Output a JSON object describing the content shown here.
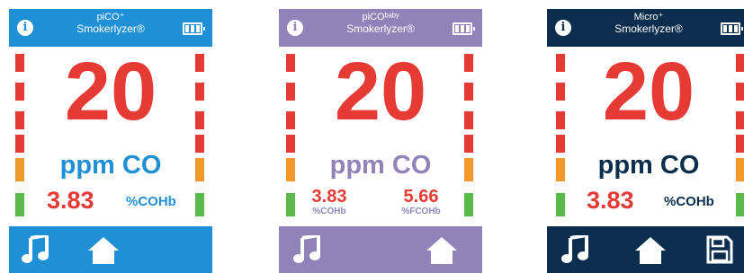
{
  "colors": {
    "pico_blue": "#1f8fd6",
    "baby_purple": "#9182b9",
    "micro_navy": "#0b2d4e",
    "reading_red": "#e63a35",
    "segment_orange": "#f2992b",
    "segment_green": "#5bb84a"
  },
  "screens": [
    {
      "theme": "pico",
      "brand_line1": "piCO⁺",
      "brand_line2": "Smokerlyzer®",
      "reading": "20",
      "unit": "ppm CO",
      "cohb_value": "3.83",
      "cohb_label": "%COHb",
      "icons": [
        "info-icon",
        "battery-icon",
        "music-note-icon",
        "home-icon"
      ]
    },
    {
      "theme": "baby",
      "brand_line1": "piCOᵇᵃᵇʸ",
      "brand_line2": "Smokerlyzer®",
      "reading": "20",
      "unit": "ppm CO",
      "cohb_value": "3.83",
      "cohb_label": "%COHb",
      "fcohb_value": "5.66",
      "fcohb_label": "%FCOHb",
      "icons": [
        "info-icon",
        "battery-icon",
        "music-note-icon",
        "home-icon"
      ]
    },
    {
      "theme": "micro",
      "brand_line1": "Micro⁺",
      "brand_line2": "Smokerlyzer®",
      "reading": "20",
      "unit": "ppm CO",
      "cohb_value": "3.83",
      "cohb_label": "%COHb",
      "icons": [
        "info-icon",
        "battery-icon",
        "music-note-icon",
        "home-icon",
        "save-icon"
      ]
    }
  ]
}
